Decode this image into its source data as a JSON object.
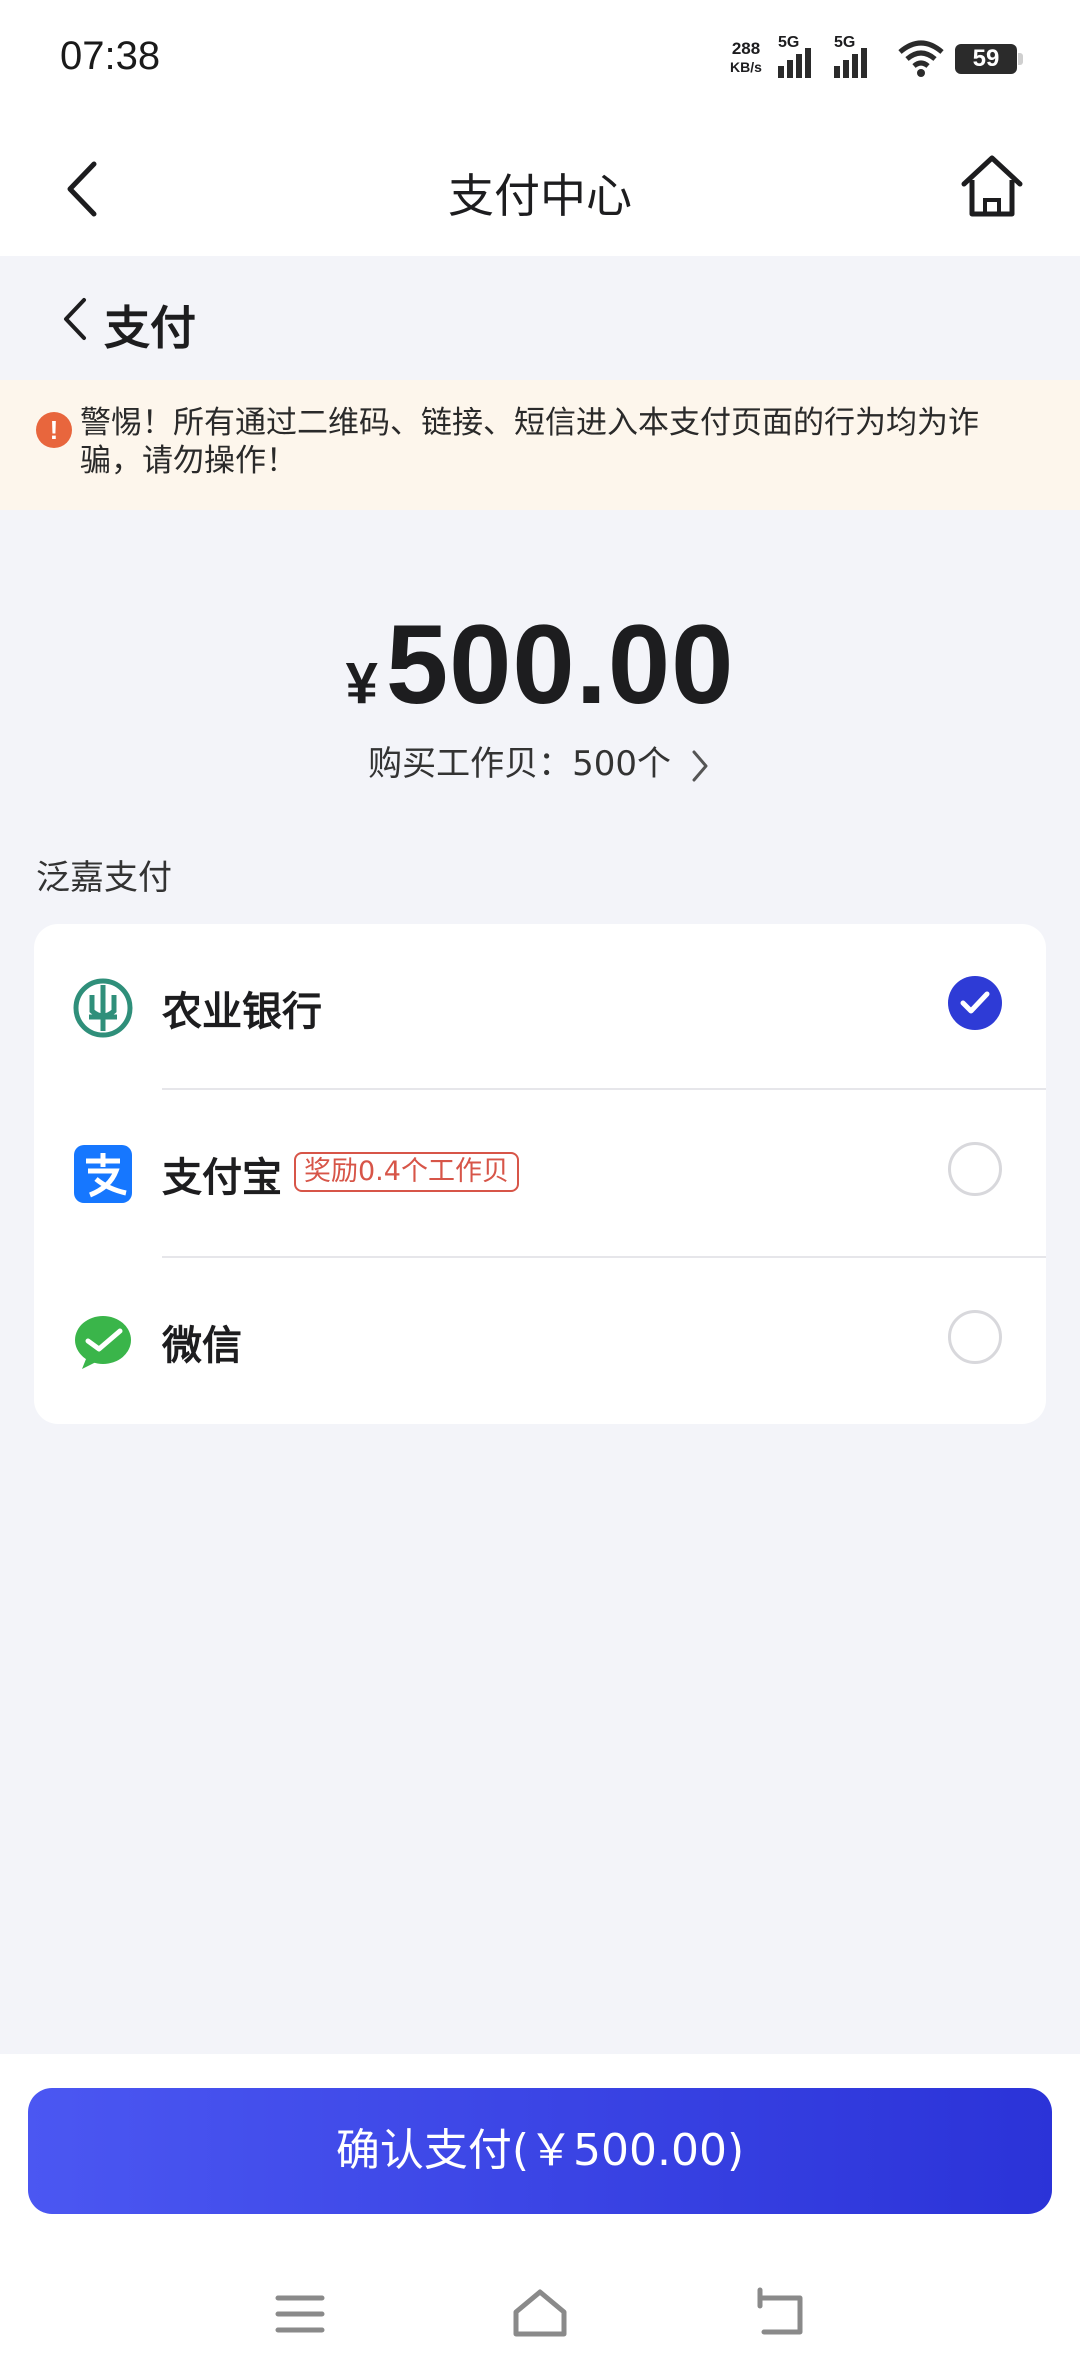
{
  "status_bar": {
    "time": "07:38",
    "net_speed_value": "288",
    "net_speed_unit": "KB/s",
    "signal1_label": "5G",
    "signal2_label": "5G",
    "battery": "59"
  },
  "nav": {
    "title": "支付中心"
  },
  "sub_header": {
    "title": "支付"
  },
  "warning": {
    "text": "警惕！所有通过二维码、链接、短信进入本支付页面的行为均为诈骗，请勿操作！"
  },
  "amount": {
    "currency": "¥",
    "value": "500.00",
    "purchase_text": "购买工作贝：500个"
  },
  "section": {
    "label": "泛嘉支付"
  },
  "payment_methods": [
    {
      "name": "农业银行",
      "icon": "abc-bank-icon",
      "selected": true
    },
    {
      "name": "支付宝",
      "icon": "alipay-icon",
      "badge": "奖励0.4个工作贝",
      "selected": false
    },
    {
      "name": "微信",
      "icon": "wechat-icon",
      "selected": false
    }
  ],
  "confirm": {
    "label": "确认支付(￥500.00)"
  },
  "colors": {
    "accent": "#2e3bd6",
    "warning_bg": "#fdf6ec",
    "warning_icon": "#e8663d",
    "badge": "#d75548"
  }
}
